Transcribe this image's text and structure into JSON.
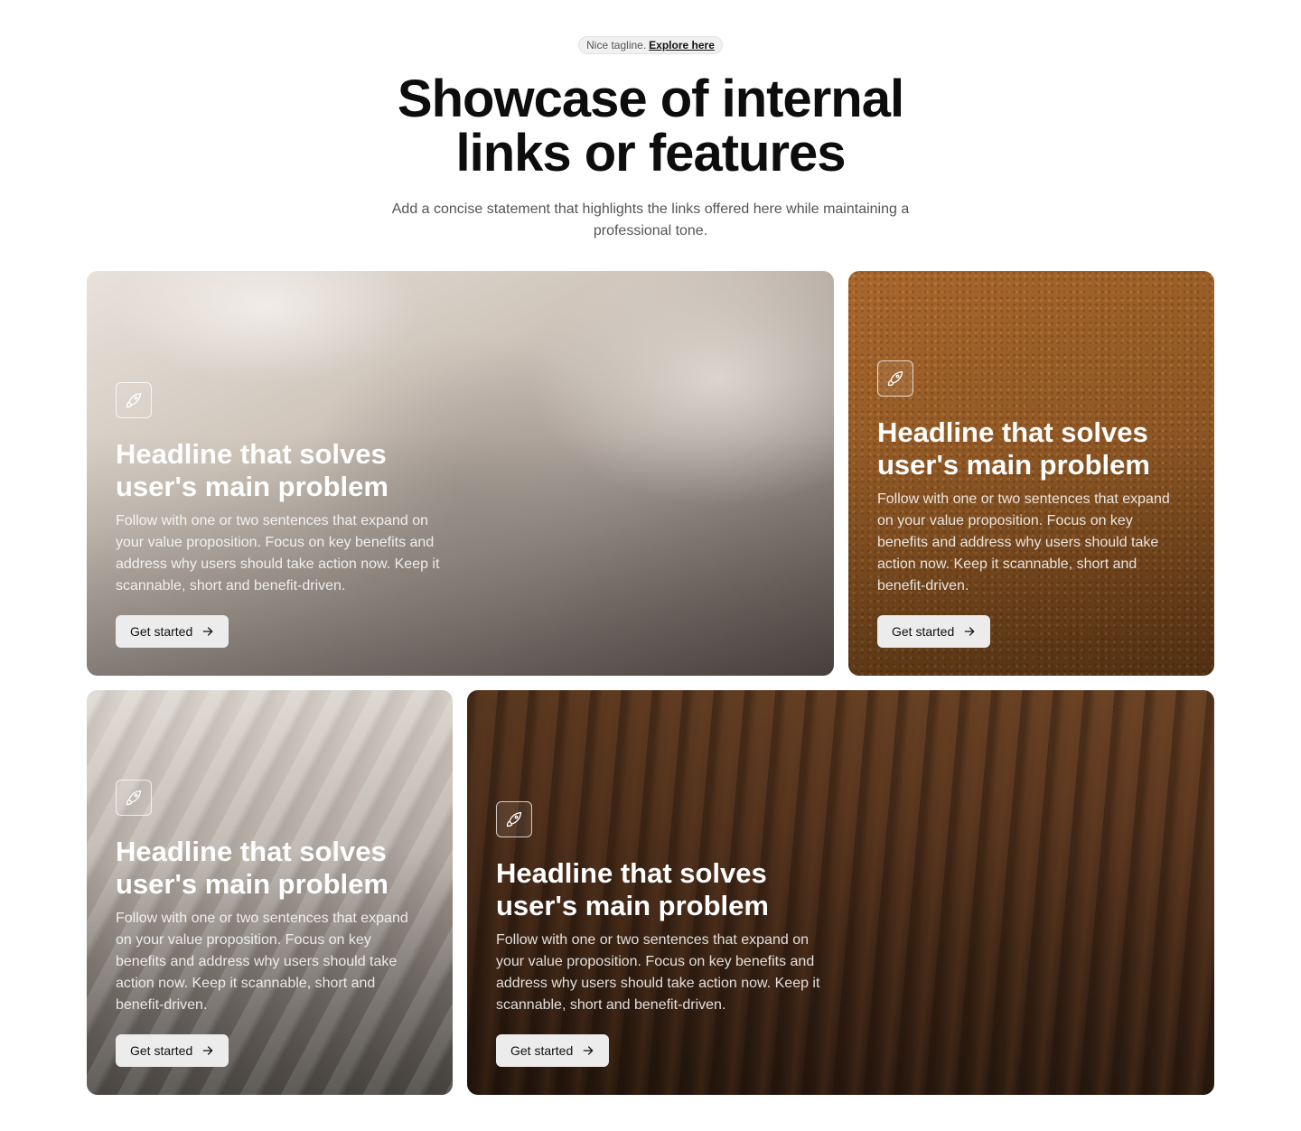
{
  "header": {
    "tagline_text": "Nice tagline.",
    "tagline_link": "Explore here",
    "title": "Showcase of internal links or features",
    "subtitle": "Add a concise statement that highlights the links offered here while maintaining a professional tone."
  },
  "cards": [
    {
      "icon": "rocket-icon",
      "title": "Headline that solves user's main problem",
      "text": "Follow with one or two sentences that expand on your value proposition. Focus on key benefits and address why users should take action now. Keep it scannable, short and benefit-driven.",
      "button": "Get started",
      "button_icon": "arrow-right-icon"
    },
    {
      "icon": "rocket-icon",
      "title": "Headline that solves user's main problem",
      "text": "Follow with one or two sentences that expand on your value proposition. Focus on key benefits and address why users should take action now. Keep it scannable, short and benefit-driven.",
      "button": "Get started",
      "button_icon": "arrow-right-icon"
    },
    {
      "icon": "rocket-icon",
      "title": "Headline that solves user's main problem",
      "text": "Follow with one or two sentences that expand on your value proposition. Focus on key benefits and address why users should take action now. Keep it scannable, short and benefit-driven.",
      "button": "Get started",
      "button_icon": "arrow-right-icon"
    },
    {
      "icon": "rocket-icon",
      "title": "Headline that solves user's main problem",
      "text": "Follow with one or two sentences that expand on your value proposition. Focus on key benefits and address why users should take action now. Keep it scannable, short and benefit-driven.",
      "button": "Get started",
      "button_icon": "arrow-right-icon"
    }
  ],
  "colors": {
    "button_bg": "#ececec",
    "title_text": "#0d0d0d",
    "card_text": "#ffffff"
  }
}
